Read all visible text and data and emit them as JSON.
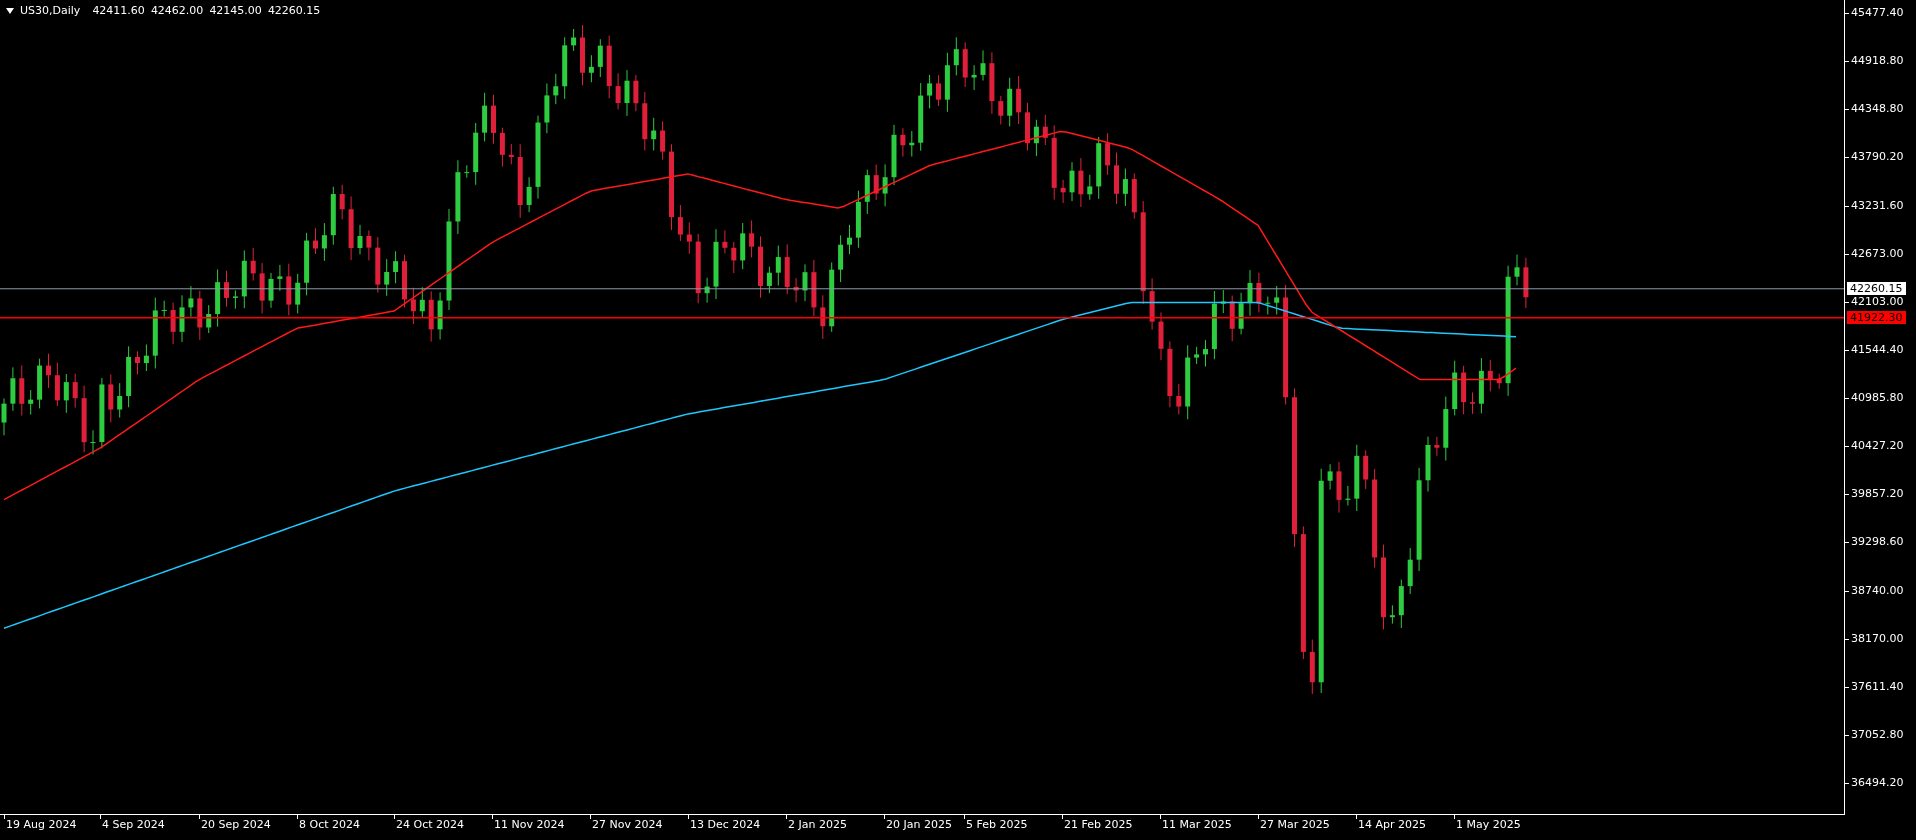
{
  "chart": {
    "symbol": "US30,Daily",
    "ohlc": [
      "42411.60",
      "42462.00",
      "42145.00",
      "42260.15"
    ]
  },
  "price_axis": {
    "labels": [
      "45477.40",
      "44918.80",
      "44348.80",
      "43790.20",
      "43231.60",
      "42673.00",
      "42103.00",
      "41544.40",
      "40985.80",
      "40427.20",
      "39857.20",
      "39298.60",
      "38740.00",
      "38170.00",
      "37611.40",
      "37052.80",
      "36494.20"
    ]
  },
  "lines": [
    {
      "kind": "bid",
      "label": "42260.15"
    },
    {
      "kind": "level",
      "label": "41922.30"
    }
  ],
  "time_axis": {
    "labels": [
      "19 Aug 2024",
      "4 Sep 2024",
      "20 Sep 2024",
      "8 Oct 2024",
      "24 Oct 2024",
      "11 Nov 2024",
      "27 Nov 2024",
      "13 Dec 2024",
      "2 Jan 2025",
      "20 Jan 2025",
      "5 Feb 2025",
      "21 Feb 2025",
      "11 Mar 2025",
      "27 Mar 2025",
      "14 Apr 2025",
      "1 May 2025"
    ]
  }
}
